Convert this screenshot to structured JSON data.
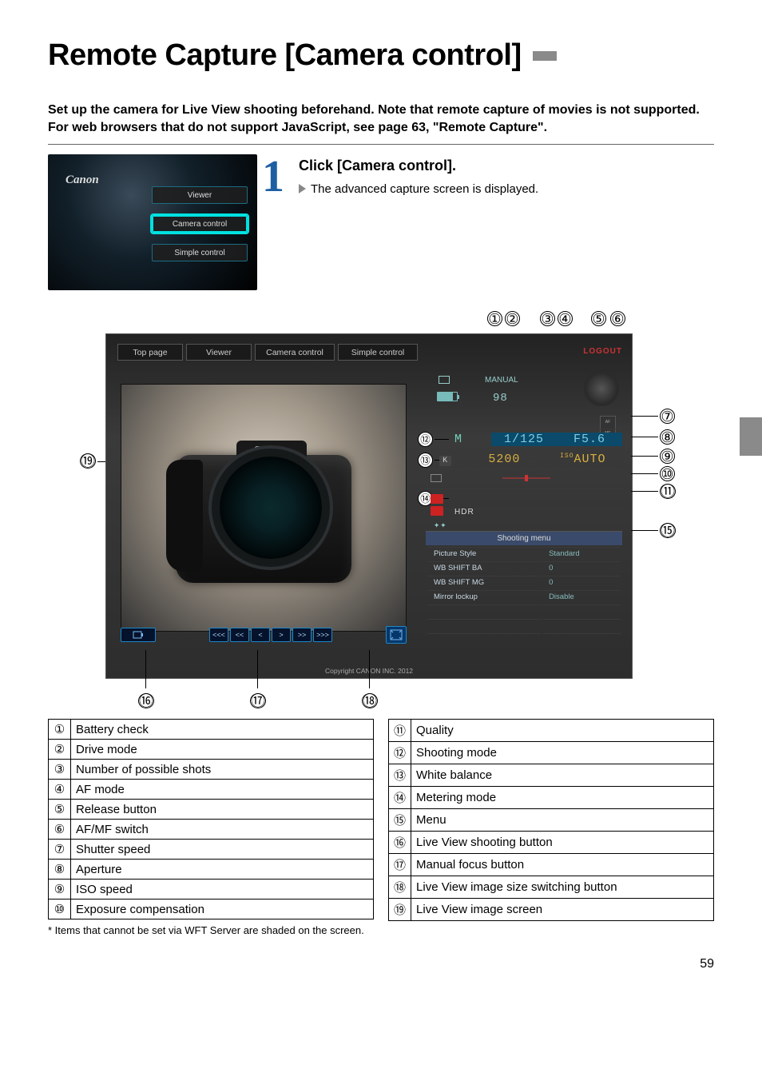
{
  "title": "Remote Capture [Camera control]",
  "intro_line1": "Set up the camera for Live View shooting beforehand. Note that remote capture of movies is not supported.",
  "intro_line2": "For web browsers that do not support JavaScript, see page 63, \"Remote Capture\".",
  "step1": {
    "number": "1",
    "heading": "Click [Camera control].",
    "detail": "The advanced capture screen is displayed.",
    "menu": {
      "logo": "Canon",
      "item1": "Viewer",
      "item2": "Camera control",
      "item3": "Simple control"
    }
  },
  "diagram": {
    "tabs": {
      "t1": "Top page",
      "t2": "Viewer",
      "t3": "Camera control",
      "t4": "Simple control"
    },
    "logout": "LOGOUT",
    "brand": "Canon",
    "panel": {
      "manual": "MANUAL",
      "shots": "98",
      "mode": "M",
      "shutter": "1/125",
      "aperture": "F5.6",
      "kelvin": "K",
      "iso": "5200",
      "iso_auto_prefix": "ISO",
      "iso_auto": "AUTO",
      "hdr": "HDR",
      "menu_header": "Shooting menu",
      "menu_rows": [
        {
          "k": "Picture Style",
          "v": "Standard"
        },
        {
          "k": "WB SHIFT BA",
          "v": "0"
        },
        {
          "k": "WB SHIFT MG",
          "v": "0"
        },
        {
          "k": "Mirror lockup",
          "v": "Disable"
        }
      ]
    },
    "focus_labels": [
      "<<<",
      "<<",
      "<",
      ">",
      ">>",
      ">>>"
    ],
    "copyright": "Copyright CANON INC. 2012"
  },
  "callouts_top": [
    "①",
    "②",
    "③",
    "④",
    "⑤",
    "⑥"
  ],
  "callouts_left": [
    "⑲"
  ],
  "callouts_right": [
    "⑦",
    "⑧",
    "⑨",
    "⑩",
    "⑪",
    "⑮"
  ],
  "callouts_inner": [
    "⑫",
    "⑬",
    "⑭"
  ],
  "callouts_bottom": [
    "⑯",
    "⑰",
    "⑱"
  ],
  "legend_left": [
    {
      "n": "①",
      "t": "Battery check"
    },
    {
      "n": "②",
      "t": "Drive mode"
    },
    {
      "n": "③",
      "t": "Number of possible shots"
    },
    {
      "n": "④",
      "t": "AF mode"
    },
    {
      "n": "⑤",
      "t": "Release button"
    },
    {
      "n": "⑥",
      "t": "AF/MF switch"
    },
    {
      "n": "⑦",
      "t": "Shutter speed"
    },
    {
      "n": "⑧",
      "t": "Aperture"
    },
    {
      "n": "⑨",
      "t": "ISO speed"
    },
    {
      "n": "⑩",
      "t": "Exposure compensation"
    }
  ],
  "legend_right": [
    {
      "n": "⑪",
      "t": "Quality"
    },
    {
      "n": "⑫",
      "t": "Shooting mode"
    },
    {
      "n": "⑬",
      "t": "White balance"
    },
    {
      "n": "⑭",
      "t": "Metering mode"
    },
    {
      "n": "⑮",
      "t": "Menu"
    },
    {
      "n": "⑯",
      "t": "Live View shooting button"
    },
    {
      "n": "⑰",
      "t": "Manual focus button"
    },
    {
      "n": "⑱",
      "t": "Live View image size switching button"
    },
    {
      "n": "⑲",
      "t": "Live View image screen"
    }
  ],
  "footnote": "*  Items that cannot be set via WFT Server are shaded on the screen.",
  "pagenum": "59"
}
